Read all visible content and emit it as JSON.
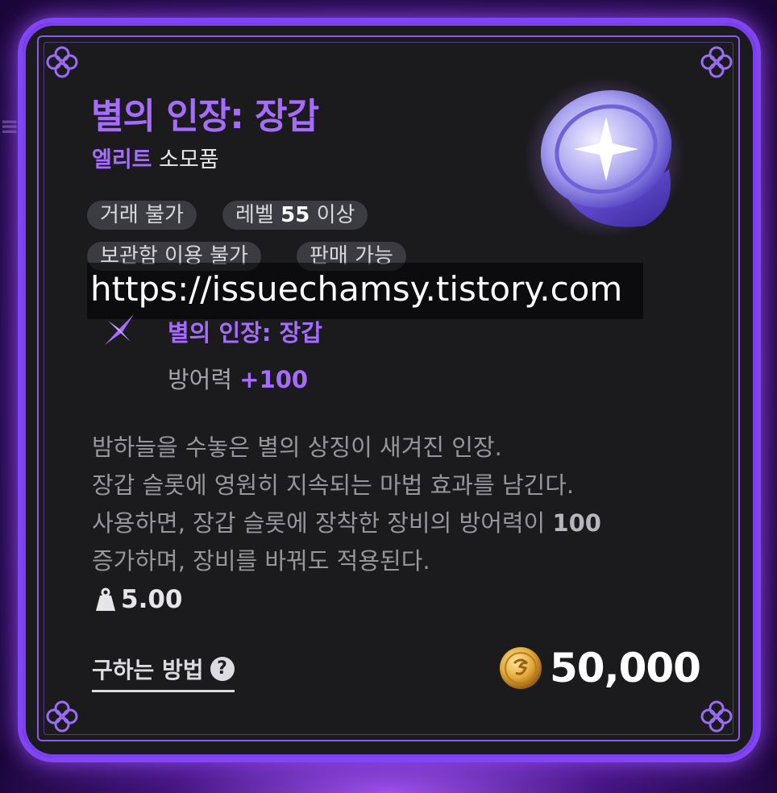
{
  "item": {
    "name": "별의 인장: 장갑",
    "grade": "엘리트",
    "category": "소모품",
    "tags": [
      "거래 불가",
      "보관함 이용 불가",
      "판매 가능"
    ],
    "level_prefix": "레벨",
    "level_value": "55",
    "level_suffix": "이상",
    "effect_name": "별의 인장: 장갑",
    "effect_stat_label": "방어력",
    "effect_stat_value": "+100",
    "description": {
      "line1": "밤하늘을 수놓은 별의 상징이 새겨진 인장.",
      "line2": "장갑 슬롯에 영원히 지속되는 마법 효과를 남긴다.",
      "line3_text": "사용하면, 장갑 슬롯에 장착한 장비의 방어력이",
      "line3_value": "100",
      "line4": "증가하며, 장비를 바꿔도 적용된다."
    },
    "weight": "5.00",
    "how_to_get": "구하는 방법",
    "price": "50,000"
  },
  "watermark": "https://issuechamsy.tistory.com",
  "icons": {
    "corner": "ornament-knot-icon",
    "weight": "weight-icon",
    "help": "question-icon",
    "coin": "gold-coin-icon",
    "effect": "star-sparkle-icon"
  },
  "colors": {
    "accent": "#a56cff",
    "frame": "#8245f5",
    "card_bg": "#1b1a1d"
  }
}
